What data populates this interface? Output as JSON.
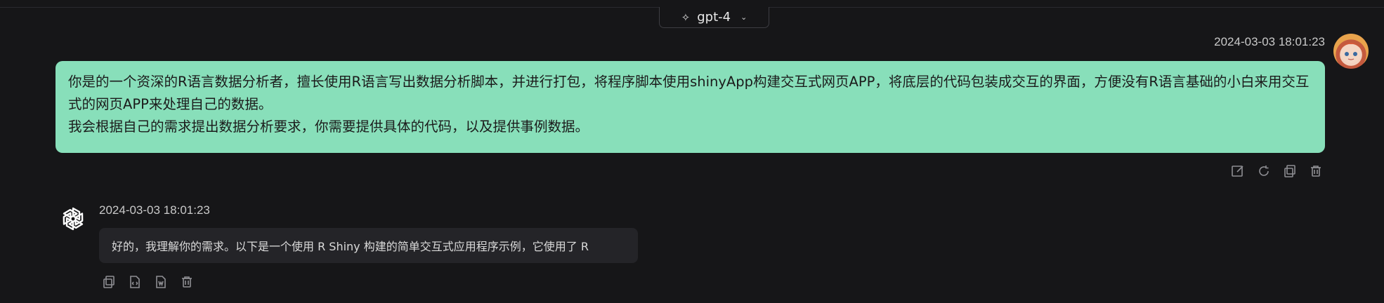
{
  "header": {
    "model_label": "gpt-4",
    "model_icon": "sparkle-icon",
    "dropdown_icon": "chevron-down-icon"
  },
  "user_message": {
    "timestamp": "2024-03-03 18:01:23",
    "text": "你是的一个资深的R语言数据分析者，擅长使用R语言写出数据分析脚本，并进行打包，将程序脚本使用shinyApp构建交互式网页APP，将底层的代码包装成交互的界面，方便没有R语言基础的小白来用交互式的网页APP来处理自己的数据。\n我会根据自己的需求提出数据分析要求，你需要提供具体的代码，以及提供事例数据。",
    "bubble_color": "#88dfba",
    "actions": [
      "edit-icon",
      "regenerate-icon",
      "copy-icon",
      "delete-icon"
    ]
  },
  "assistant_message": {
    "timestamp": "2024-03-03 18:01:23",
    "text": "好的，我理解你的需求。以下是一个使用 R Shiny 构建的简单交互式应用程序示例，它使用了 R",
    "actions": [
      "copy-icon",
      "code-icon",
      "word-export-icon",
      "delete-icon"
    ]
  }
}
